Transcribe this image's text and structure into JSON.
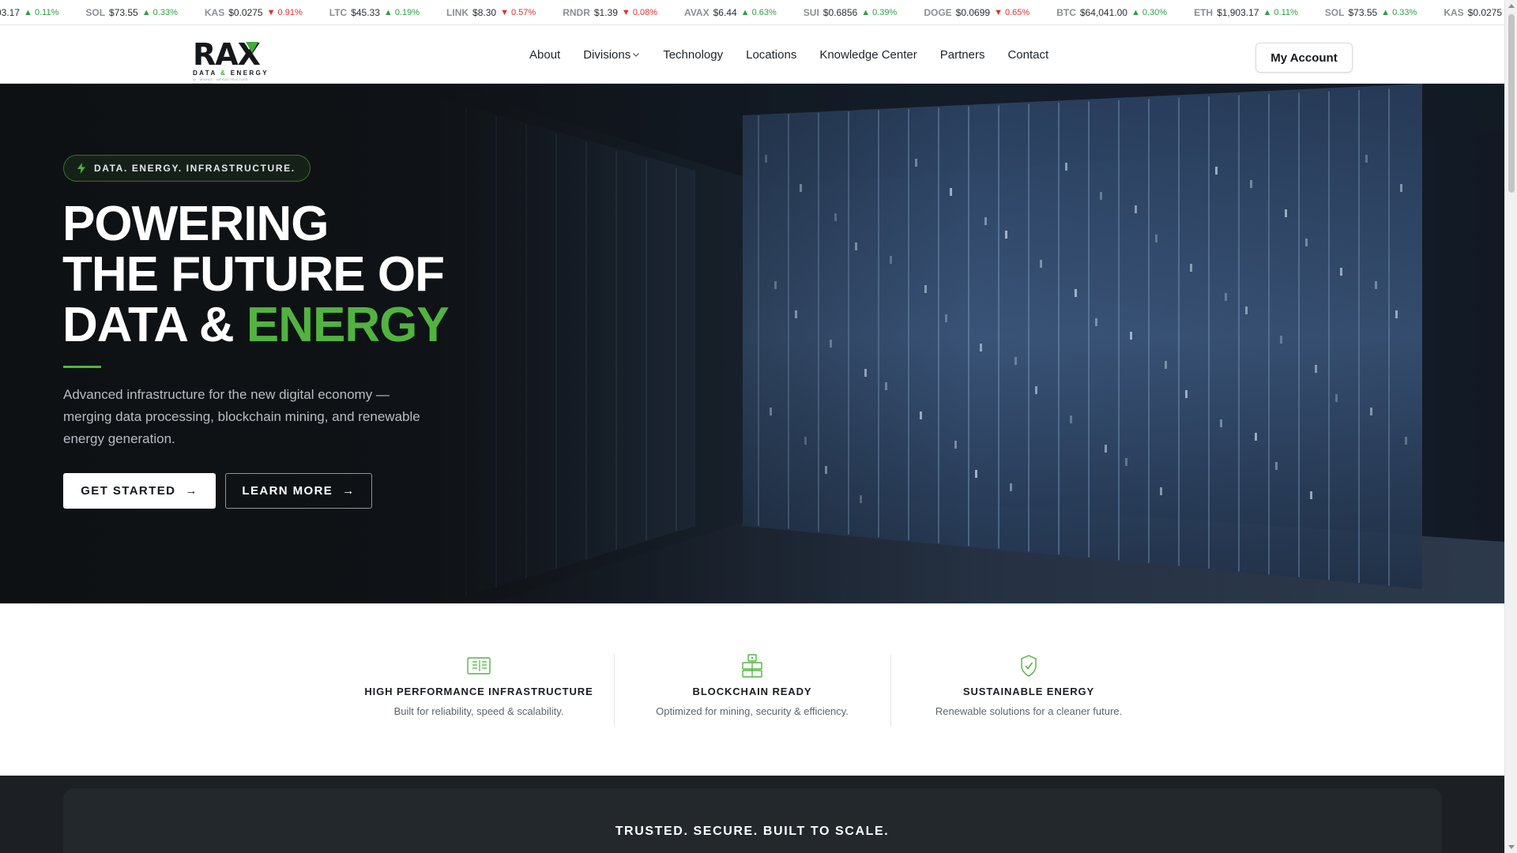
{
  "ticker": [
    {
      "symbol": "",
      "price": "03.17",
      "direction": "up",
      "change": "▲ 0.11%"
    },
    {
      "symbol": "SOL",
      "price": "$73.55",
      "direction": "up",
      "change": "▲ 0.33%"
    },
    {
      "symbol": "KAS",
      "price": "$0.0275",
      "direction": "down",
      "change": "▼ 0.91%"
    },
    {
      "symbol": "LTC",
      "price": "$45.33",
      "direction": "up",
      "change": "▲ 0.19%"
    },
    {
      "symbol": "LINK",
      "price": "$8.30",
      "direction": "down",
      "change": "▼ 0.57%"
    },
    {
      "symbol": "RNDR",
      "price": "$1.39",
      "direction": "down",
      "change": "▼ 0.08%"
    },
    {
      "symbol": "AVAX",
      "price": "$6.44",
      "direction": "up",
      "change": "▲ 0.63%"
    },
    {
      "symbol": "SUI",
      "price": "$0.6856",
      "direction": "up",
      "change": "▲ 0.39%"
    },
    {
      "symbol": "DOGE",
      "price": "$0.0699",
      "direction": "down",
      "change": "▼ 0.65%"
    },
    {
      "symbol": "BTC",
      "price": "$64,041.00",
      "direction": "up",
      "change": "▲ 0.30%"
    },
    {
      "symbol": "ETH",
      "price": "$1,903.17",
      "direction": "up",
      "change": "▲ 0.11%"
    },
    {
      "symbol": "SOL",
      "price": "$73.55",
      "direction": "up",
      "change": "▲ 0.33%"
    },
    {
      "symbol": "KAS",
      "price": "$0.0275",
      "direction": "down",
      "change": "▼"
    }
  ],
  "header": {
    "logo": {
      "main_left": "RA",
      "main_x": "X",
      "sub_left": "DATA ",
      "sub_amp": "&",
      "sub_right": " ENERGY",
      "tagline": "AI · MINING · INFRASTRUCTURE · SOLUTIONS"
    },
    "nav": [
      "About",
      "Divisions",
      "Technology",
      "Locations",
      "Knowledge Center",
      "Partners",
      "Contact"
    ],
    "account_label": "My Account"
  },
  "hero": {
    "badge": "DATA. ENERGY. INFRASTRUCTURE.",
    "title_line1": "POWERING",
    "title_line2": "THE FUTURE OF",
    "title_line3_prefix": "DATA & ",
    "title_line3_accent": "ENERGY",
    "description": "Advanced infrastructure for the new digital economy — merging data processing, blockchain mining, and renewable energy generation.",
    "primary_cta": "GET STARTED",
    "secondary_cta": "LEARN MORE",
    "arrow": "→"
  },
  "features": [
    {
      "icon": "server-rack-icon",
      "title": "HIGH PERFORMANCE INFRASTRUCTURE",
      "description": "Built for reliability, speed & scalability."
    },
    {
      "icon": "blockchain-blocks-icon",
      "title": "BLOCKCHAIN READY",
      "description": "Optimized for mining, security & efficiency."
    },
    {
      "icon": "leaf-shield-icon",
      "title": "SUSTAINABLE ENERGY",
      "description": "Renewable solutions for a cleaner future."
    }
  ],
  "trusted": {
    "title": "TRUSTED. SECURE. BUILT TO SCALE."
  },
  "colors": {
    "accent": "#52b340",
    "dark": "#1c2024",
    "up": "#2f9e44",
    "down": "#e03131"
  }
}
